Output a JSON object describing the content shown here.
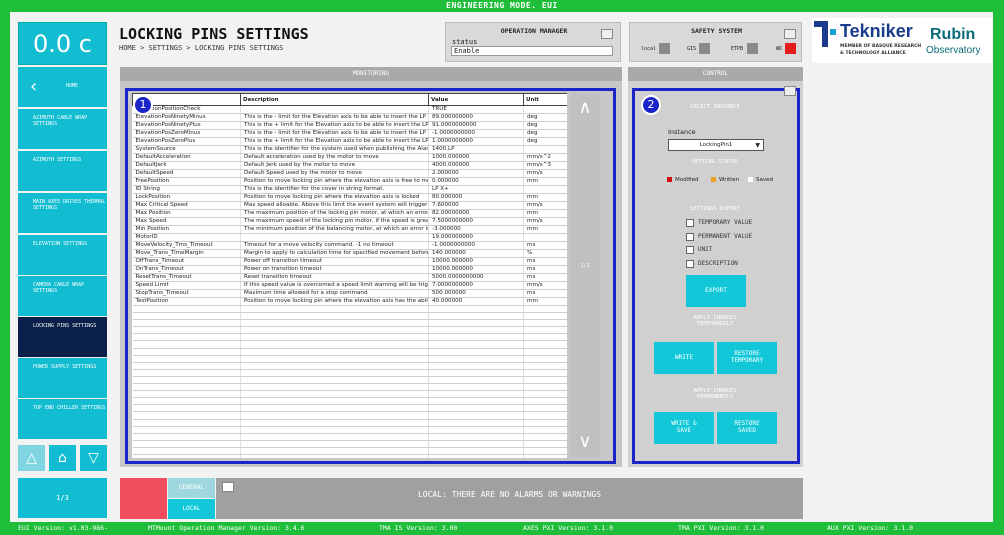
{
  "top_banner": "ENGINEERING MODE. EUI",
  "clock": "0.0 c",
  "sidebar": {
    "back_label": "HOME",
    "items": [
      {
        "label": "AZIMUTH CABLE WRAP SETTINGS"
      },
      {
        "label": "AZIMUTH SETTINGS"
      },
      {
        "label": "MAIN AXES DRIVES THERMAL SETTINGS"
      },
      {
        "label": "ELEVATION SETTINGS"
      },
      {
        "label": "CAMERA CABLE WRAP SETTINGS"
      },
      {
        "label": "LOCKING PINS SETTINGS"
      },
      {
        "label": "POWER SUPPLY SETTINGS"
      },
      {
        "label": "TOP END CHILLER SETTINGS"
      }
    ],
    "page": "1/3"
  },
  "header": {
    "title": "LOCKING PINS SETTINGS",
    "breadcrumb": "HOME > SETTINGS > LOCKING PINS SETTINGS"
  },
  "operation_manager": {
    "title": "OPERATION MANAGER",
    "status_label": "status",
    "status_value": "Enable"
  },
  "safety": {
    "title": "SAFETY SYSTEM",
    "items": [
      {
        "label": "local",
        "color": "#8a8a8a"
      },
      {
        "label": "GIS",
        "color": "#8a8a8a"
      },
      {
        "label": "ETPB",
        "color": "#8a8a8a"
      },
      {
        "label": "WD",
        "color": "#e31b1b"
      }
    ]
  },
  "logo": {
    "tekniker": "Tekniker",
    "tekniker_sub1": "MEMBER OF BASQUE RESEARCH",
    "tekniker_sub2": "& TECHNOLOGY ALLIANCE",
    "rubin1": "Rubin",
    "rubin2": "Observatory"
  },
  "monitoring": {
    "title": "MONITORING",
    "badge": "1",
    "columns": [
      "Description",
      "Value",
      "Unit"
    ],
    "first_col_header": "",
    "page": "1/1",
    "rows": [
      [
        "ElevationPositionCheck",
        "",
        "TRUE",
        ""
      ],
      [
        "ElevationPosNinetyMinus",
        "This is the - limit for the Elevation axis to be able to insert the LP at 90",
        "89.000000000",
        "deg"
      ],
      [
        "ElevationPosNinetyPlus",
        "This is the + limit for the Elevation axis to be able to insert the LP at 90",
        "91.0000000000",
        "deg"
      ],
      [
        "ElevationPosZeroMinus",
        "This is the - limit for the Elevation axis to be able to insert the LP at 0 d",
        "-1.0000000000",
        "deg"
      ],
      [
        "ElevationPosZeroPlus",
        "This is the + limit for the Elevation axis to be able to insert the LP at 0 d",
        "1.0000000000",
        "deg"
      ],
      [
        "SystemSource",
        "This is the identifier for the system used when publishing the Alarm sou",
        "1400.LP",
        ""
      ],
      [
        "DefaultAcceleration",
        "Default acceleration used by the motor to move",
        "1000.000000",
        "mm/s^2"
      ],
      [
        "DefaultJerk",
        "Default Jerk used by the motor to move",
        "4000.000000",
        "mm/s^3"
      ],
      [
        "DefaultSpeed",
        "Default Speed used by the motor to move",
        "2.000000",
        "mm/s"
      ],
      [
        "FreePosition",
        "Position to move locking pin where the elevation axis is free to move",
        "0.000000",
        "mm"
      ],
      [
        "ID String",
        "This is the identifier for the cover in string format.",
        "LP X+",
        ""
      ],
      [
        "LockPosition",
        "Position to move locking pin where the elevation axis is locked",
        "80.000000",
        "mm"
      ],
      [
        "Max Critical Speed",
        "Max speed alloable. Above this limit the event system will trigger an ala",
        "7.600000",
        "mm/s"
      ],
      [
        "Max Position",
        "The maximum position of the locking pin motor, at which an error is fire",
        "82.00000000",
        "mm"
      ],
      [
        "Max Speed",
        "The maximum speed of the locking pin motor, if the speed is greater th",
        "7.5000000000",
        "mm/s"
      ],
      [
        "Min Position",
        "The minimum position of the balancing motor, at which an error is fired",
        "-3.000000",
        "mm"
      ],
      [
        "MotorID",
        "",
        "19.000000000",
        ""
      ],
      [
        "MoveVelocity_Tms_Timeout",
        "Timeout for a move velocity command. -1 no timeout",
        "-1.0000000000",
        "ms"
      ],
      [
        "Move_Trans_TimeMargin",
        "Margin to apply to calculation time for specified movement before a tim",
        "140.000000",
        "%"
      ],
      [
        "OffTrans_Timeout",
        "Power off transition timeout",
        "10000.000000",
        "ms"
      ],
      [
        "OnTrans_Timeout",
        "Power on transition timeout",
        "10000.000000",
        "ms"
      ],
      [
        "ResetTrans_Timeout",
        "Reset transition timeout",
        "5000.0000000000",
        "ms"
      ],
      [
        "Speed Limit",
        "If this speed value is overcomed a speed limit warning will be triggered",
        "7.0000000000",
        "mm/s"
      ],
      [
        "StopTrans_Timeout",
        "Maximum time allowed for a stop command",
        "500.000000",
        "ms"
      ],
      [
        "TestPosition",
        "Position to move locking pin where the elevation axis has the ability to",
        "40.000000",
        "mm"
      ]
    ]
  },
  "control": {
    "title": "CONTROL",
    "badge": "2",
    "select_instance": "SELECT INSTANCE",
    "instance_label": "Instance",
    "instance_value": "LockingPin1",
    "setting_status": "SETTING STATUS",
    "legend": [
      {
        "label": "Modified",
        "color": "#d01010"
      },
      {
        "label": "Written",
        "color": "#f0a020"
      },
      {
        "label": "Saved",
        "color": "#ffffff"
      }
    ],
    "settings_export": "SETTINGS EXPORT",
    "checks": [
      "TEMPORARY VALUE",
      "PERMANENT VALUE",
      "UNIT",
      "DESCRIPTION"
    ],
    "export_btn": "EXPORT",
    "apply_temp": "APPLY CHANGES TEMPORARILY",
    "write_btn": "WRITE",
    "restore_temp_btn": "RESTORE TEMPORARY",
    "apply_perm": "APPLY CHANGES PERMANENTLY",
    "write_save_btn": "WRITE & SAVE",
    "restore_saved_btn": "RESTORE SAVED"
  },
  "alarm": {
    "general": "GENERAL",
    "local": "LOCAL",
    "message": "LOCAL: THERE ARE NO ALARMS OR WARNINGS"
  },
  "footer": {
    "eui": "EUI Version: v1.03-986-",
    "mtmount": "MTMount Operation Manager Version: 3.4.6",
    "tma_is": "TMA IS Version: 3.00",
    "axes": "AXES PXI Version: 3.1.0",
    "tma_pxi": "TMA PXI Version: 3.1.0",
    "aux": "AUX PXI Version: 3.1.0"
  }
}
